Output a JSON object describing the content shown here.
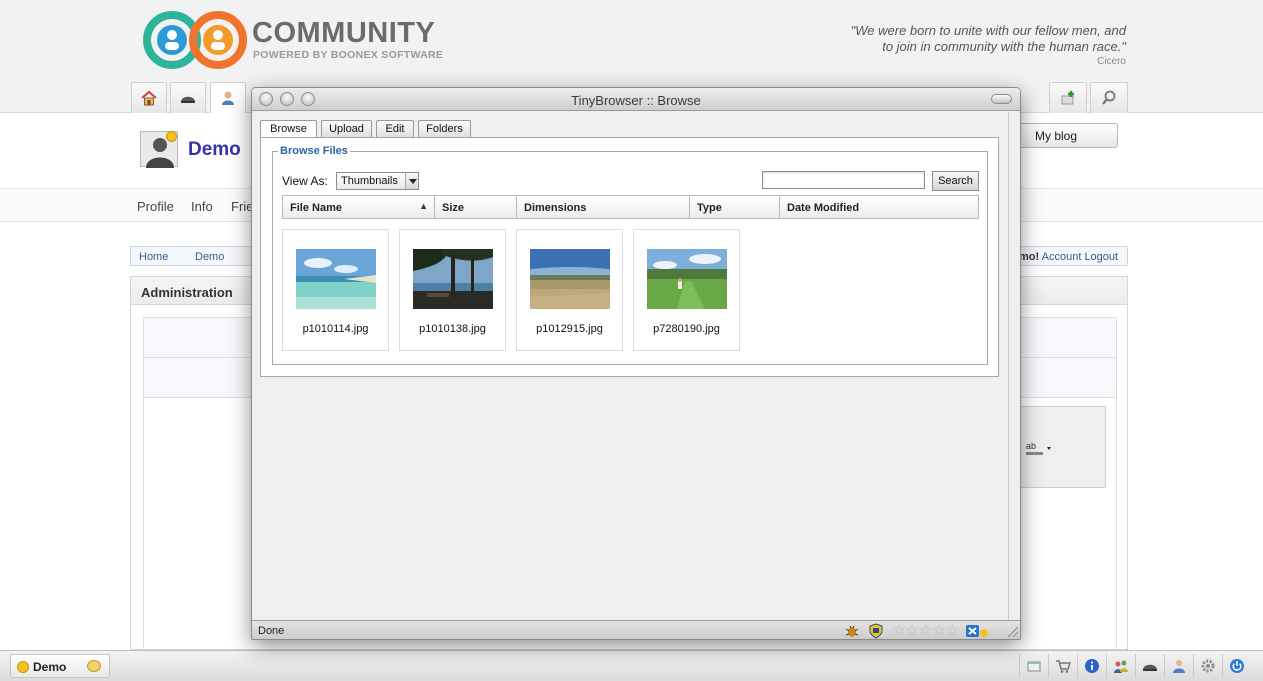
{
  "site": {
    "brand": "COMMUNITY",
    "brand_sub": "POWERED BY BOONEX SOFTWARE",
    "quote_line1": "\"We were born to unite with our fellow men, and",
    "quote_line2": "to join in community with the human race.\"",
    "quote_author": "Cicero",
    "nav_icons": [
      "home-icon",
      "helmet-icon",
      "user-icon"
    ],
    "nav_right_icons": [
      "add-icon",
      "search-icon"
    ]
  },
  "profile": {
    "name": "Demo",
    "my_blog": "My blog",
    "subnav": [
      "Profile",
      "Info",
      "Frie"
    ]
  },
  "breadcrumb": [
    "Home",
    "Demo"
  ],
  "account": {
    "greeting_tail": "mo!",
    "account_link": "Account",
    "logout_link": "Logout"
  },
  "admin": {
    "title": "Administration"
  },
  "tray": {
    "user": "Demo",
    "icons": [
      "window-icon",
      "cart-icon",
      "info-icon",
      "people-icon",
      "helmet-icon",
      "user-icon",
      "gear-icon",
      "power-icon"
    ]
  },
  "browser": {
    "window_title": "TinyBrowser :: Browse",
    "tabs": [
      "Browse",
      "Upload",
      "Edit",
      "Folders"
    ],
    "legend": "Browse Files",
    "view_as_label": "View As:",
    "view_as_value": "Thumbnails",
    "search_value": "",
    "search_button": "Search",
    "columns": [
      "File Name",
      "Size",
      "Dimensions",
      "Type",
      "Date Modified"
    ],
    "sort_arrow": "▲",
    "files": [
      {
        "name": "p1010114.jpg",
        "scene": "beach"
      },
      {
        "name": "p1010138.jpg",
        "scene": "pines"
      },
      {
        "name": "p1012915.jpg",
        "scene": "field"
      },
      {
        "name": "p7280190.jpg",
        "scene": "lawn"
      }
    ],
    "status": "Done"
  },
  "colors": {
    "brand_teal": "#2eb39b",
    "brand_orange": "#f0742e",
    "brand_blue": "#2c9ad6",
    "link_blue": "#3a5a8a",
    "legend_blue": "#2a64a8",
    "profile_name": "#3333aa"
  }
}
